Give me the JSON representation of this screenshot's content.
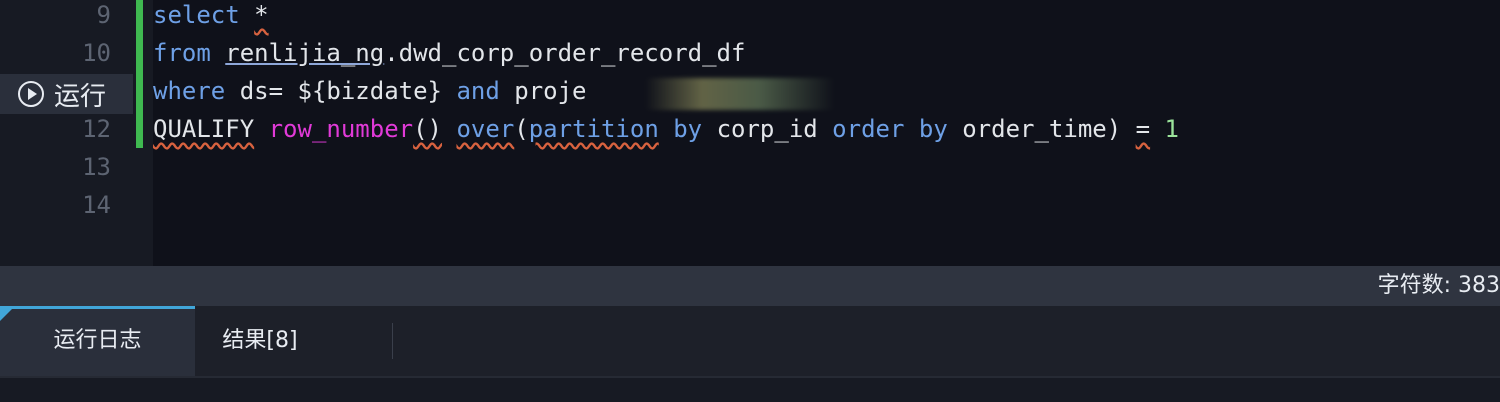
{
  "editor": {
    "line_numbers": [
      "9",
      "10",
      "12",
      "13",
      "14"
    ],
    "run_button_label": "运行",
    "code": {
      "line9": {
        "select": "select",
        "star": "*"
      },
      "line10": {
        "from": "from",
        "schema": "renlijia_ng",
        "table": ".dwd_corp_order_record_df"
      },
      "line11": {
        "where": "where",
        "ds": " ds= ",
        "bizdate": "${bizdate}",
        "and": "and",
        "project": " proje"
      },
      "line12": {
        "qualify": "QUALIFY",
        "row_number": "row_number",
        "parens": "()",
        "over": "over",
        "open": "(",
        "partition": "partition",
        "by1": "by",
        "corp_id": " corp_id ",
        "order": "order",
        "by2": "by",
        "order_time": " order_time) ",
        "eq": "=",
        "one": "1"
      }
    }
  },
  "status_bar": {
    "char_count_label": "字符数: 383"
  },
  "bottom_panel": {
    "tabs": [
      {
        "label": "运行日志"
      },
      {
        "label": "结果[8]"
      }
    ]
  },
  "colors": {
    "background": "#0f111a",
    "gutter": "#171a23",
    "change_bar": "#3fb950",
    "keyword": "#6ea0e6",
    "function": "#e13ad8",
    "number": "#9be39b",
    "active_tab_accent": "#41a6d9"
  }
}
